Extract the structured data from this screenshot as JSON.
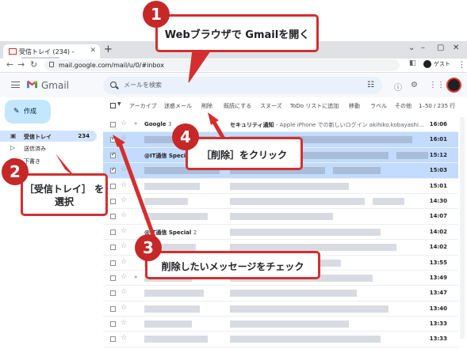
{
  "browser": {
    "tab_title": "受信トレイ (234) -",
    "new_tab": "+",
    "url": "mail.google.com/mail/u/0/#inbox",
    "profile_label": "ゲスト",
    "window_controls": [
      "⌄",
      "–",
      "▢",
      "✕"
    ]
  },
  "gmail": {
    "app_name": "Gmail",
    "search_placeholder": "メールを検索",
    "compose_label": "作成",
    "sidebar": [
      {
        "label": "受信トレイ",
        "count": "234",
        "active": true
      },
      {
        "label": "送信済み",
        "count": "",
        "active": false
      },
      {
        "label": "下書き",
        "count": "",
        "active": false
      }
    ],
    "toolbar": {
      "archive": "アーカイブ",
      "spam": "迷惑メール",
      "delete": "削除",
      "mark_read": "既読にする",
      "snooze": "スヌーズ",
      "todo": "ToDo リストに追加",
      "move": "移動",
      "label": "ラベル",
      "more": "その他",
      "pagination": "1–50 / 235 行"
    },
    "messages": [
      {
        "sender": "Google",
        "count": "3",
        "subject": "セキュリティ通知",
        "snippet": " - Apple iPhone での新しいログイン akihiko.kobayashi...",
        "time": "16:06",
        "selected": false,
        "important": true
      },
      {
        "sender": "",
        "count": "",
        "subject": "",
        "snippet": "",
        "time": "16:01",
        "selected": true,
        "important": false
      },
      {
        "sender": "@IT通信 Special",
        "count": "",
        "subject": "",
        "snippet": "",
        "time": "15:12",
        "selected": true,
        "important": false
      },
      {
        "sender": "",
        "count": "",
        "subject": "",
        "snippet": "",
        "time": "15:03",
        "selected": true,
        "important": false
      },
      {
        "sender": "",
        "count": "",
        "subject": "",
        "snippet": "",
        "time": "15:01",
        "selected": false,
        "important": false
      },
      {
        "sender": "",
        "count": "",
        "subject": "",
        "snippet": "",
        "time": "14:30",
        "selected": false,
        "important": false
      },
      {
        "sender": "",
        "count": "",
        "subject": "",
        "snippet": "",
        "time": "14:07",
        "selected": false,
        "important": false
      },
      {
        "sender": "@IT通信 Special",
        "count": "2",
        "subject": "",
        "snippet": "",
        "time": "14:02",
        "selected": false,
        "important": false
      },
      {
        "sender": "",
        "count": "",
        "subject": "",
        "snippet": "",
        "time": "14:02",
        "selected": false,
        "important": false
      },
      {
        "sender": "",
        "count": "",
        "subject": "",
        "snippet": "",
        "time": "13:55",
        "selected": false,
        "important": false
      },
      {
        "sender": "",
        "count": "",
        "subject": "",
        "snippet": "",
        "time": "13:49",
        "selected": false,
        "important": true
      },
      {
        "sender": "",
        "count": "",
        "subject": "",
        "snippet": "",
        "time": "13:47",
        "selected": false,
        "important": false
      },
      {
        "sender": "",
        "count": "",
        "subject": "",
        "snippet": "",
        "time": "13:40",
        "selected": false,
        "important": false
      },
      {
        "sender": "",
        "count": "",
        "subject": "",
        "snippet": "",
        "time": "13:33",
        "selected": false,
        "important": false
      },
      {
        "sender": "",
        "count": "",
        "subject": "",
        "snippet": "",
        "time": "13:33",
        "selected": false,
        "important": false
      }
    ]
  },
  "annotations": [
    {
      "number": "1",
      "text": "Webブラウザで Gmailを開く"
    },
    {
      "number": "2",
      "text": "［受信トレイ］ を選択"
    },
    {
      "number": "3",
      "text": "削除したいメッセージをチェック"
    },
    {
      "number": "4",
      "text": "［削除］をクリック"
    }
  ],
  "colors": {
    "annotation_red": "#d32f2f",
    "badge_red": "#c62828",
    "selected_row": "#c2dbff",
    "compose_bg": "#c2e7ff",
    "inbox_active": "#d3e3fd"
  }
}
